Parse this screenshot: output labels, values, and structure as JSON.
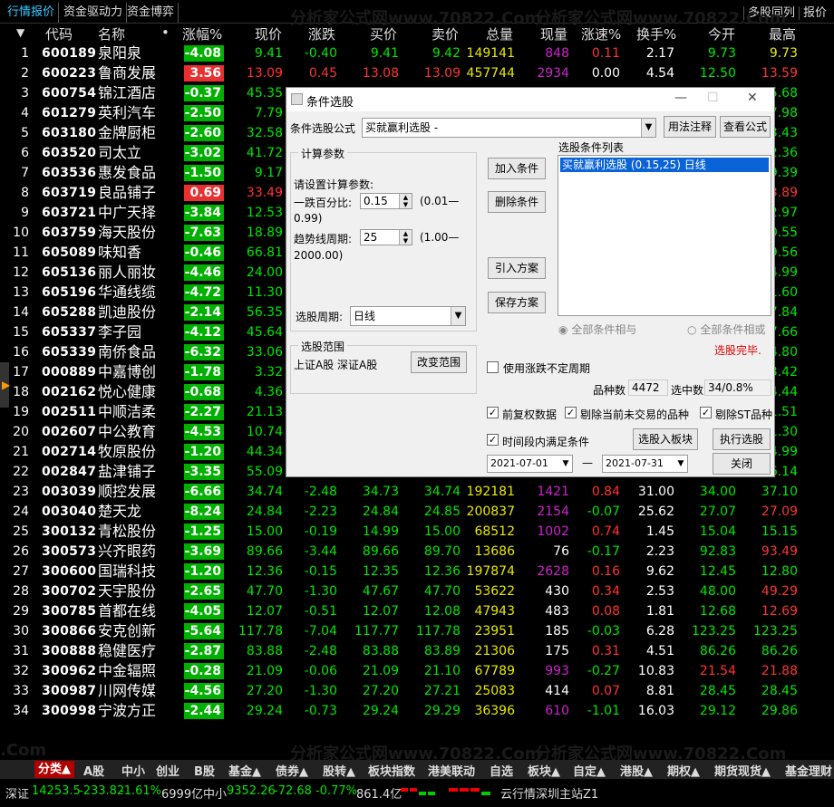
{
  "top_tabs": [
    "行情报价",
    "资金驱动力",
    "资金博弈"
  ],
  "top_right": [
    "多股同列",
    "报价"
  ],
  "headers": {
    "code": "代码",
    "name": "名称",
    "dot": "•",
    "pct": "涨幅%",
    "price": "现价",
    "change": "涨跌",
    "buy": "买价",
    "sell": "卖价",
    "vol": "总量",
    "cur": "现量",
    "speed": "涨速%",
    "turnover": "换手%",
    "open": "今开",
    "high": "最高"
  },
  "rows": [
    {
      "n": "1",
      "code": "600189",
      "name": "泉阳泉",
      "pct": "-4.08",
      "price": "9.41",
      "chg": "-0.40",
      "buy": "9.41",
      "sell": "9.42",
      "vol": "149141",
      "cur": "848",
      "speed": "0.11",
      "turn": "2.17",
      "open": "9.73",
      "high": "9.73"
    },
    {
      "n": "2",
      "code": "600223",
      "name": "鲁商发展",
      "pct": "3.56",
      "price": "13.09",
      "chg": "0.45",
      "buy": "13.08",
      "sell": "13.09",
      "vol": "457744",
      "cur": "2934",
      "speed": "0.00",
      "turn": "4.54",
      "open": "12.50",
      "high": "13.59"
    },
    {
      "n": "3",
      "code": "600754",
      "name": "锦江酒店",
      "pct": "-0.37",
      "price": "45.35",
      "chg": "",
      "buy": "",
      "sell": "",
      "vol": "",
      "cur": "",
      "speed": "",
      "turn": "",
      "open": "",
      "high": "5.68"
    },
    {
      "n": "4",
      "code": "601279",
      "name": "英利汽车",
      "pct": "-2.50",
      "price": "7.79",
      "chg": "",
      "buy": "",
      "sell": "",
      "vol": "",
      "cur": "",
      "speed": "",
      "turn": "",
      "open": "",
      "high": "7.98"
    },
    {
      "n": "5",
      "code": "603180",
      "name": "金牌厨柜",
      "pct": "-2.60",
      "price": "32.58",
      "chg": "",
      "buy": "",
      "sell": "",
      "vol": "",
      "cur": "",
      "speed": "",
      "turn": "",
      "open": "",
      "high": "3.43"
    },
    {
      "n": "6",
      "code": "603520",
      "name": "司太立",
      "pct": "-3.02",
      "price": "41.72",
      "chg": "",
      "buy": "",
      "sell": "",
      "vol": "",
      "cur": "",
      "speed": "",
      "turn": "",
      "open": "",
      "high": "2.36"
    },
    {
      "n": "7",
      "code": "603536",
      "name": "惠发食品",
      "pct": "-1.50",
      "price": "9.17",
      "chg": "",
      "buy": "",
      "sell": "",
      "vol": "",
      "cur": "",
      "speed": "",
      "turn": "",
      "open": "",
      "high": "9.39"
    },
    {
      "n": "8",
      "code": "603719",
      "name": "良品铺子",
      "pct": "0.69",
      "price": "33.49",
      "chg": "",
      "buy": "",
      "sell": "",
      "vol": "",
      "cur": "",
      "speed": "",
      "turn": "",
      "open": "",
      "high": "3.89"
    },
    {
      "n": "9",
      "code": "603721",
      "name": "中广天择",
      "pct": "-3.84",
      "price": "12.53",
      "chg": "",
      "buy": "",
      "sell": "",
      "vol": "",
      "cur": "",
      "speed": "",
      "turn": "",
      "open": "",
      "high": "2.97"
    },
    {
      "n": "10",
      "code": "603759",
      "name": "海天股份",
      "pct": "-7.63",
      "price": "18.89",
      "chg": "",
      "buy": "",
      "sell": "",
      "vol": "",
      "cur": "",
      "speed": "",
      "turn": "",
      "open": "",
      "high": "0.55"
    },
    {
      "n": "11",
      "code": "605089",
      "name": "味知香",
      "pct": "-0.46",
      "price": "66.81",
      "chg": "",
      "buy": "",
      "sell": "",
      "vol": "",
      "cur": "",
      "speed": "",
      "turn": "",
      "open": "",
      "high": "9.56"
    },
    {
      "n": "12",
      "code": "605136",
      "name": "丽人丽妆",
      "pct": "-4.46",
      "price": "24.00",
      "chg": "",
      "buy": "",
      "sell": "",
      "vol": "",
      "cur": "",
      "speed": "",
      "turn": "",
      "open": "",
      "high": "4.99"
    },
    {
      "n": "13",
      "code": "605196",
      "name": "华通线缆",
      "pct": "-4.72",
      "price": "11.30",
      "chg": "",
      "buy": "",
      "sell": "",
      "vol": "",
      "cur": "",
      "speed": "",
      "turn": "",
      "open": "",
      "high": "1.60"
    },
    {
      "n": "14",
      "code": "605288",
      "name": "凯迪股份",
      "pct": "-2.14",
      "price": "56.35",
      "chg": "",
      "buy": "",
      "sell": "",
      "vol": "",
      "cur": "",
      "speed": "",
      "turn": "",
      "open": "",
      "high": "7.84"
    },
    {
      "n": "15",
      "code": "605337",
      "name": "李子园",
      "pct": "-4.12",
      "price": "45.64",
      "chg": "",
      "buy": "",
      "sell": "",
      "vol": "",
      "cur": "",
      "speed": "",
      "turn": "",
      "open": "",
      "high": "7.66"
    },
    {
      "n": "16",
      "code": "605339",
      "name": "南侨食品",
      "pct": "-6.32",
      "price": "33.06",
      "chg": "",
      "buy": "",
      "sell": "",
      "vol": "",
      "cur": "",
      "speed": "",
      "turn": "",
      "open": "",
      "high": "4.80"
    },
    {
      "n": "17",
      "code": "000889",
      "name": "中嘉博创",
      "pct": "-1.78",
      "price": "3.32",
      "chg": "",
      "buy": "",
      "sell": "",
      "vol": "",
      "cur": "",
      "speed": "",
      "turn": "",
      "open": "",
      "high": "3.42"
    },
    {
      "n": "18",
      "code": "002162",
      "name": "悦心健康",
      "pct": "-0.68",
      "price": "4.36",
      "chg": "",
      "buy": "",
      "sell": "",
      "vol": "",
      "cur": "",
      "speed": "",
      "turn": "",
      "open": "",
      "high": "4.44"
    },
    {
      "n": "19",
      "code": "002511",
      "name": "中顺洁柔",
      "pct": "-2.27",
      "price": "21.13",
      "chg": "",
      "buy": "",
      "sell": "",
      "vol": "",
      "cur": "",
      "speed": "",
      "turn": "",
      "open": "",
      "high": "1.51"
    },
    {
      "n": "20",
      "code": "002607",
      "name": "中公教育",
      "pct": "-4.53",
      "price": "10.74",
      "chg": "",
      "buy": "",
      "sell": "",
      "vol": "",
      "cur": "",
      "speed": "",
      "turn": "",
      "open": "",
      "high": "1.30"
    },
    {
      "n": "21",
      "code": "002714",
      "name": "牧原股份",
      "pct": "-1.20",
      "price": "44.34",
      "chg": "",
      "buy": "",
      "sell": "",
      "vol": "",
      "cur": "",
      "speed": "",
      "turn": "",
      "open": "",
      "high": "4.99"
    },
    {
      "n": "22",
      "code": "002847",
      "name": "盐津铺子",
      "pct": "-3.35",
      "price": "55.09",
      "chg": "",
      "buy": "",
      "sell": "",
      "vol": "",
      "cur": "",
      "speed": "",
      "turn": "",
      "open": "",
      "high": "6.14"
    },
    {
      "n": "23",
      "code": "003039",
      "name": "顺控发展",
      "pct": "-6.66",
      "price": "34.74",
      "chg": "-2.48",
      "buy": "34.73",
      "sell": "34.74",
      "vol": "192181",
      "cur": "1421",
      "speed": "0.84",
      "turn": "31.00",
      "open": "34.00",
      "high": "37.10"
    },
    {
      "n": "24",
      "code": "003040",
      "name": "楚天龙",
      "pct": "-8.24",
      "price": "24.84",
      "chg": "-2.23",
      "buy": "24.84",
      "sell": "24.85",
      "vol": "200837",
      "cur": "2154",
      "speed": "-0.07",
      "turn": "25.62",
      "open": "27.07",
      "high": "27.09"
    },
    {
      "n": "25",
      "code": "300132",
      "name": "青松股份",
      "pct": "-1.25",
      "price": "15.00",
      "chg": "-0.19",
      "buy": "14.99",
      "sell": "15.00",
      "vol": "68512",
      "cur": "1002",
      "speed": "0.74",
      "turn": "1.45",
      "open": "15.04",
      "high": "15.15"
    },
    {
      "n": "26",
      "code": "300573",
      "name": "兴齐眼药",
      "pct": "-3.69",
      "price": "89.66",
      "chg": "-3.44",
      "buy": "89.66",
      "sell": "89.70",
      "vol": "13686",
      "cur": "76",
      "speed": "-0.17",
      "turn": "2.23",
      "open": "92.83",
      "high": "93.49"
    },
    {
      "n": "27",
      "code": "300600",
      "name": "国瑞科技",
      "pct": "-1.20",
      "price": "12.36",
      "chg": "-0.15",
      "buy": "12.35",
      "sell": "12.36",
      "vol": "197874",
      "cur": "2628",
      "speed": "0.16",
      "turn": "9.62",
      "open": "12.45",
      "high": "12.80"
    },
    {
      "n": "28",
      "code": "300702",
      "name": "天宇股份",
      "pct": "-2.65",
      "price": "47.70",
      "chg": "-1.30",
      "buy": "47.67",
      "sell": "47.70",
      "vol": "53622",
      "cur": "430",
      "speed": "0.34",
      "turn": "2.53",
      "open": "48.00",
      "high": "49.29"
    },
    {
      "n": "29",
      "code": "300785",
      "name": "首都在线",
      "pct": "-4.05",
      "price": "12.07",
      "chg": "-0.51",
      "buy": "12.07",
      "sell": "12.08",
      "vol": "47943",
      "cur": "483",
      "speed": "0.08",
      "turn": "1.81",
      "open": "12.68",
      "high": "12.69"
    },
    {
      "n": "30",
      "code": "300866",
      "name": "安克创新",
      "pct": "-5.64",
      "price": "117.78",
      "chg": "-7.04",
      "buy": "117.77",
      "sell": "117.78",
      "vol": "23951",
      "cur": "185",
      "speed": "-0.03",
      "turn": "6.28",
      "open": "123.25",
      "high": "123.25"
    },
    {
      "n": "31",
      "code": "300888",
      "name": "稳健医疗",
      "pct": "-2.87",
      "price": "83.88",
      "chg": "-2.48",
      "buy": "83.88",
      "sell": "83.89",
      "vol": "21306",
      "cur": "175",
      "speed": "0.31",
      "turn": "4.51",
      "open": "86.26",
      "high": "86.26"
    },
    {
      "n": "32",
      "code": "300962",
      "name": "中金辐照",
      "pct": "-0.28",
      "price": "21.09",
      "chg": "-0.06",
      "buy": "21.09",
      "sell": "21.10",
      "vol": "67789",
      "cur": "993",
      "speed": "-0.27",
      "turn": "10.83",
      "open": "21.54",
      "high": "21.88"
    },
    {
      "n": "33",
      "code": "300987",
      "name": "川网传媒",
      "pct": "-4.56",
      "price": "27.20",
      "chg": "-1.30",
      "buy": "27.20",
      "sell": "27.21",
      "vol": "25083",
      "cur": "414",
      "speed": "0.07",
      "turn": "8.81",
      "open": "28.45",
      "high": "28.45"
    },
    {
      "n": "34",
      "code": "300998",
      "name": "宁波方正",
      "pct": "-2.44",
      "price": "29.24",
      "chg": "-0.73",
      "buy": "29.24",
      "sell": "29.29",
      "vol": "36396",
      "cur": "610",
      "speed": "-1.01",
      "turn": "16.03",
      "open": "29.12",
      "high": "29.86"
    }
  ],
  "dialog": {
    "title": "条件选股",
    "formula_label": "条件选股公式",
    "formula_value": "买就赢利选股 -",
    "usage_btn": "用法注释",
    "view_btn": "查看公式",
    "calc_group": "计算参数",
    "set_params": "请设置计算参数:",
    "param1_label": "一跌百分比:",
    "param1_value": "0.15",
    "param1_range": "(0.01—",
    "param1_range2": "0.99)",
    "param2_label": "趋势线周期:",
    "param2_value": "25",
    "param2_range": "(1.00—",
    "param2_range2": "2000.00)",
    "period_label": "选股周期:",
    "period_value": "日线",
    "add_btn": "加入条件",
    "del_btn": "删除条件",
    "import_btn": "引入方案",
    "save_btn": "保存方案",
    "list_label": "选股条件列表",
    "list_item": "买就赢利选股 (0.15,25) 日线",
    "radio_and": "全部条件相与",
    "radio_or": "全部条件相或",
    "status": "选股完毕.",
    "range_group": "选股范围",
    "range_text": "上证A股  深证A股",
    "change_range": "改变范围",
    "unfixed_label": "使用涨跌不定周期",
    "count_label": "品种数",
    "count_value": "4472",
    "selected_label": "选中数",
    "selected_value": "34/0.8%",
    "chk1": "前复权数据",
    "chk2": "剔除当前未交易的品种",
    "chk3": "剔除ST品种",
    "chk4": "时间段内满足条件",
    "to_block_btn": "选股入板块",
    "exec_btn": "执行选股",
    "close_btn": "关闭",
    "date_from": "2021-07-01",
    "dash": "—",
    "date_to": "2021-07-31"
  },
  "bottom_tabs": [
    "分类▲",
    "A股",
    "中小",
    "创业",
    "B股",
    "基金▲",
    "债券▲",
    "股转▲",
    "板块指数",
    "港美联动",
    "自选",
    "板块▲",
    "自定▲",
    "港股▲",
    "期权▲",
    "期货现货▲",
    "基金理财"
  ],
  "status": {
    "sz_label": "深证",
    "sz_val": "14253.5",
    "sz_chg": "-233.82",
    "sz_pct": "-1.61%",
    "sz_amt": "6999亿",
    "zx_label": "中小",
    "zx_val": "9352.26",
    "zx_chg": "-72.68",
    "zx_pct": "-0.77%",
    "zx_amt": "861.4亿",
    "server": "云行情深圳主站Z1"
  },
  "watermark": "分析家公式网www.70822.Com",
  "colors": {
    "up": "#ff3333",
    "down": "#00e600",
    "green_box": "#00b000",
    "red_box": "#e83030",
    "yellow": "#e8e800",
    "magenta": "#d020d0",
    "cyan": "#3cf"
  }
}
